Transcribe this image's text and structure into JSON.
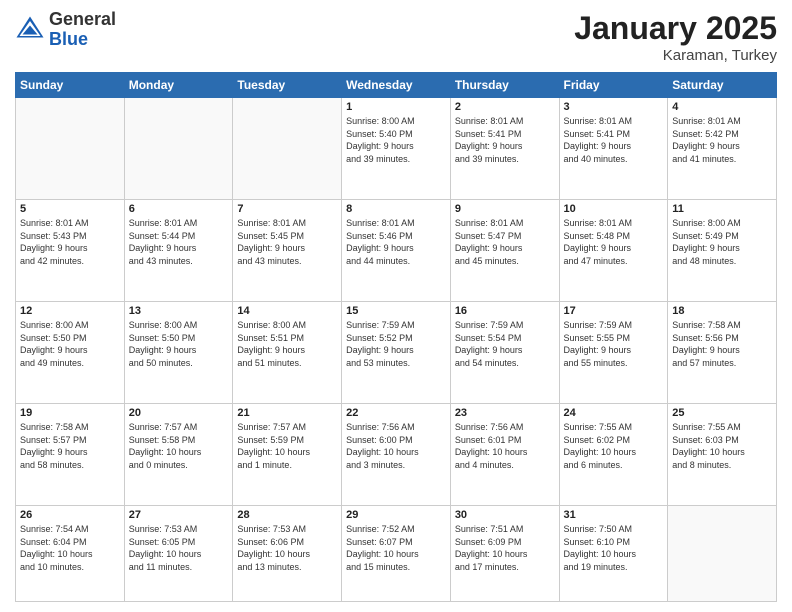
{
  "header": {
    "logo": {
      "general": "General",
      "blue": "Blue"
    },
    "title": "January 2025",
    "subtitle": "Karaman, Turkey"
  },
  "weekdays": [
    "Sunday",
    "Monday",
    "Tuesday",
    "Wednesday",
    "Thursday",
    "Friday",
    "Saturday"
  ],
  "weeks": [
    [
      {
        "day": "",
        "info": ""
      },
      {
        "day": "",
        "info": ""
      },
      {
        "day": "",
        "info": ""
      },
      {
        "day": "1",
        "info": "Sunrise: 8:00 AM\nSunset: 5:40 PM\nDaylight: 9 hours\nand 39 minutes."
      },
      {
        "day": "2",
        "info": "Sunrise: 8:01 AM\nSunset: 5:41 PM\nDaylight: 9 hours\nand 39 minutes."
      },
      {
        "day": "3",
        "info": "Sunrise: 8:01 AM\nSunset: 5:41 PM\nDaylight: 9 hours\nand 40 minutes."
      },
      {
        "day": "4",
        "info": "Sunrise: 8:01 AM\nSunset: 5:42 PM\nDaylight: 9 hours\nand 41 minutes."
      }
    ],
    [
      {
        "day": "5",
        "info": "Sunrise: 8:01 AM\nSunset: 5:43 PM\nDaylight: 9 hours\nand 42 minutes."
      },
      {
        "day": "6",
        "info": "Sunrise: 8:01 AM\nSunset: 5:44 PM\nDaylight: 9 hours\nand 43 minutes."
      },
      {
        "day": "7",
        "info": "Sunrise: 8:01 AM\nSunset: 5:45 PM\nDaylight: 9 hours\nand 43 minutes."
      },
      {
        "day": "8",
        "info": "Sunrise: 8:01 AM\nSunset: 5:46 PM\nDaylight: 9 hours\nand 44 minutes."
      },
      {
        "day": "9",
        "info": "Sunrise: 8:01 AM\nSunset: 5:47 PM\nDaylight: 9 hours\nand 45 minutes."
      },
      {
        "day": "10",
        "info": "Sunrise: 8:01 AM\nSunset: 5:48 PM\nDaylight: 9 hours\nand 47 minutes."
      },
      {
        "day": "11",
        "info": "Sunrise: 8:00 AM\nSunset: 5:49 PM\nDaylight: 9 hours\nand 48 minutes."
      }
    ],
    [
      {
        "day": "12",
        "info": "Sunrise: 8:00 AM\nSunset: 5:50 PM\nDaylight: 9 hours\nand 49 minutes."
      },
      {
        "day": "13",
        "info": "Sunrise: 8:00 AM\nSunset: 5:50 PM\nDaylight: 9 hours\nand 50 minutes."
      },
      {
        "day": "14",
        "info": "Sunrise: 8:00 AM\nSunset: 5:51 PM\nDaylight: 9 hours\nand 51 minutes."
      },
      {
        "day": "15",
        "info": "Sunrise: 7:59 AM\nSunset: 5:52 PM\nDaylight: 9 hours\nand 53 minutes."
      },
      {
        "day": "16",
        "info": "Sunrise: 7:59 AM\nSunset: 5:54 PM\nDaylight: 9 hours\nand 54 minutes."
      },
      {
        "day": "17",
        "info": "Sunrise: 7:59 AM\nSunset: 5:55 PM\nDaylight: 9 hours\nand 55 minutes."
      },
      {
        "day": "18",
        "info": "Sunrise: 7:58 AM\nSunset: 5:56 PM\nDaylight: 9 hours\nand 57 minutes."
      }
    ],
    [
      {
        "day": "19",
        "info": "Sunrise: 7:58 AM\nSunset: 5:57 PM\nDaylight: 9 hours\nand 58 minutes."
      },
      {
        "day": "20",
        "info": "Sunrise: 7:57 AM\nSunset: 5:58 PM\nDaylight: 10 hours\nand 0 minutes."
      },
      {
        "day": "21",
        "info": "Sunrise: 7:57 AM\nSunset: 5:59 PM\nDaylight: 10 hours\nand 1 minute."
      },
      {
        "day": "22",
        "info": "Sunrise: 7:56 AM\nSunset: 6:00 PM\nDaylight: 10 hours\nand 3 minutes."
      },
      {
        "day": "23",
        "info": "Sunrise: 7:56 AM\nSunset: 6:01 PM\nDaylight: 10 hours\nand 4 minutes."
      },
      {
        "day": "24",
        "info": "Sunrise: 7:55 AM\nSunset: 6:02 PM\nDaylight: 10 hours\nand 6 minutes."
      },
      {
        "day": "25",
        "info": "Sunrise: 7:55 AM\nSunset: 6:03 PM\nDaylight: 10 hours\nand 8 minutes."
      }
    ],
    [
      {
        "day": "26",
        "info": "Sunrise: 7:54 AM\nSunset: 6:04 PM\nDaylight: 10 hours\nand 10 minutes."
      },
      {
        "day": "27",
        "info": "Sunrise: 7:53 AM\nSunset: 6:05 PM\nDaylight: 10 hours\nand 11 minutes."
      },
      {
        "day": "28",
        "info": "Sunrise: 7:53 AM\nSunset: 6:06 PM\nDaylight: 10 hours\nand 13 minutes."
      },
      {
        "day": "29",
        "info": "Sunrise: 7:52 AM\nSunset: 6:07 PM\nDaylight: 10 hours\nand 15 minutes."
      },
      {
        "day": "30",
        "info": "Sunrise: 7:51 AM\nSunset: 6:09 PM\nDaylight: 10 hours\nand 17 minutes."
      },
      {
        "day": "31",
        "info": "Sunrise: 7:50 AM\nSunset: 6:10 PM\nDaylight: 10 hours\nand 19 minutes."
      },
      {
        "day": "",
        "info": ""
      }
    ]
  ]
}
